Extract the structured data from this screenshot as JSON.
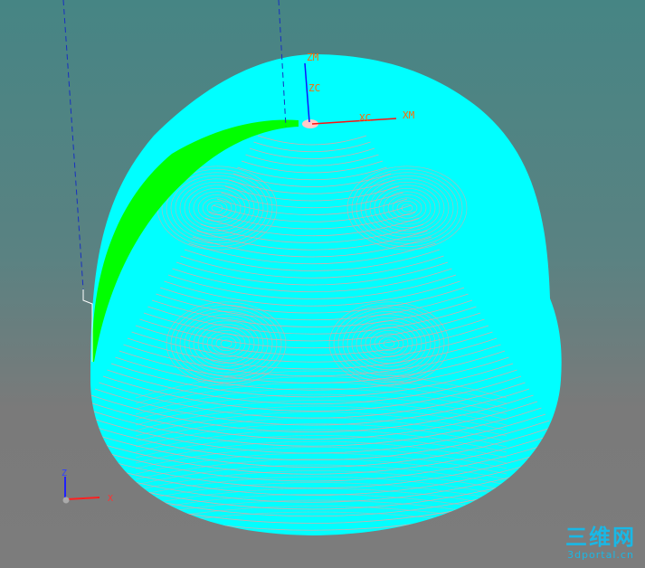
{
  "viewport": {
    "machine_axes": {
      "z": "ZM",
      "x": "XM"
    },
    "csys_axes": {
      "z": "ZC",
      "x": "XC"
    },
    "triad": {
      "z": "Z",
      "x": "X"
    }
  },
  "watermark": {
    "title": "三维网",
    "site": "3dportal.cn"
  },
  "colors": {
    "part": "#00ffff",
    "toolpath": "#f2a0a0",
    "cut_region": "#00ff00",
    "axis_x": "#ff2020",
    "axis_z": "#2020ff"
  }
}
